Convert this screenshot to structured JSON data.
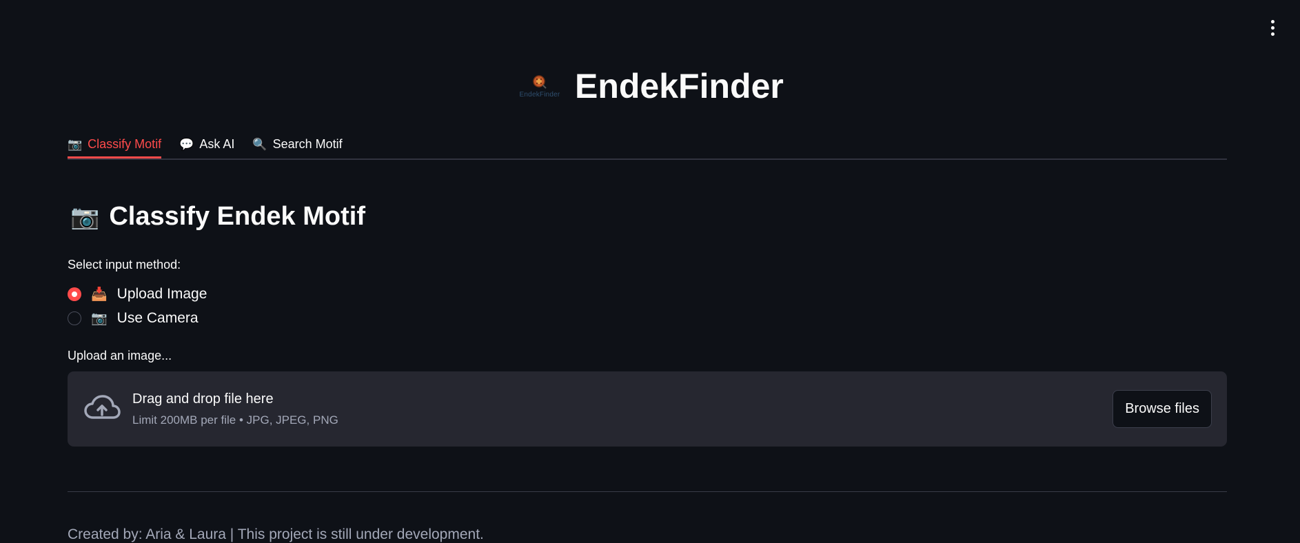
{
  "app": {
    "title": "EndekFinder",
    "logo_caption": "EndekFinder"
  },
  "tabs": [
    {
      "label": "Classify Motif",
      "icon": "camera-icon",
      "active": true
    },
    {
      "label": "Ask AI",
      "icon": "speech-bubble-icon",
      "active": false
    },
    {
      "label": "Search Motif",
      "icon": "magnifier-icon",
      "active": false
    }
  ],
  "section": {
    "title": "Classify Endek Motif",
    "icon": "camera-icon"
  },
  "input_method": {
    "label": "Select input method:",
    "options": [
      {
        "label": "Upload Image",
        "icon": "inbox-tray-icon",
        "selected": true
      },
      {
        "label": "Use Camera",
        "icon": "camera-icon",
        "selected": false
      }
    ]
  },
  "uploader": {
    "label": "Upload an image...",
    "drop_text": "Drag and drop file here",
    "limit_text": "Limit 200MB per file • JPG, JPEG, PNG",
    "browse_label": "Browse files"
  },
  "footer": {
    "text": "Created by: Aria & Laura | This project is still under development."
  },
  "colors": {
    "background": "#0e1117",
    "accent": "#ff4b4b",
    "surface": "#262730",
    "muted_text": "#a3a8b8"
  }
}
